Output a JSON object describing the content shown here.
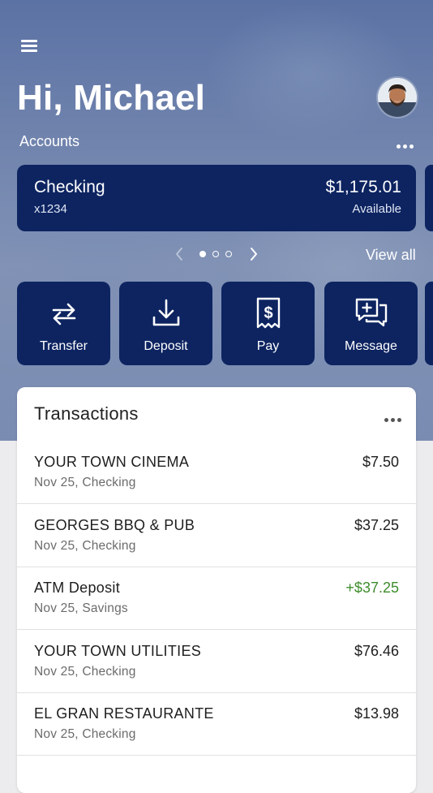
{
  "greeting": "Hi, Michael",
  "accounts": {
    "label": "Accounts",
    "view_all": "View all",
    "pager": {
      "total": 3,
      "active": 1
    },
    "cards": [
      {
        "name": "Checking",
        "number": "x1234",
        "balance": "$1,175.01",
        "balance_label": "Available"
      }
    ]
  },
  "actions": [
    {
      "label": "Transfer",
      "icon": "transfer-arrows-icon"
    },
    {
      "label": "Deposit",
      "icon": "download-tray-icon"
    },
    {
      "label": "Pay",
      "icon": "dollar-receipt-icon"
    },
    {
      "label": "Message",
      "icon": "chat-bubbles-plus-icon"
    }
  ],
  "transactions": {
    "title": "Transactions",
    "items": [
      {
        "merchant": "YOUR TOWN CINEMA",
        "meta": "Nov 25, Checking",
        "amount": "$7.50",
        "credit": false
      },
      {
        "merchant": "GEORGES BBQ & PUB",
        "meta": "Nov 25, Checking",
        "amount": "$37.25",
        "credit": false
      },
      {
        "merchant": "ATM Deposit",
        "meta": "Nov 25, Savings",
        "amount": "+$37.25",
        "credit": true
      },
      {
        "merchant": "YOUR TOWN UTILITIES",
        "meta": "Nov 25, Checking",
        "amount": "$76.46",
        "credit": false
      },
      {
        "merchant": "EL GRAN RESTAURANTE",
        "meta": "Nov 25, Checking",
        "amount": "$13.98",
        "credit": false
      }
    ]
  },
  "colors": {
    "navy": "#0d2461",
    "credit_green": "#3e8d2c"
  }
}
